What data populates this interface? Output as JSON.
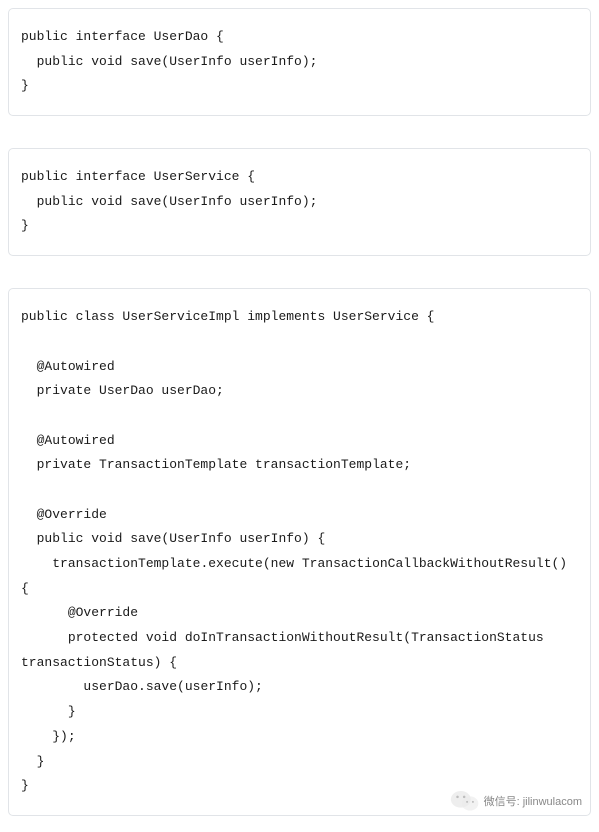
{
  "codeBlocks": [
    {
      "content": "public interface UserDao {\n  public void save(UserInfo userInfo);\n}"
    },
    {
      "content": "public interface UserService {\n  public void save(UserInfo userInfo);\n}"
    },
    {
      "content": "public class UserServiceImpl implements UserService {\n\n  @Autowired\n  private UserDao userDao;\n\n  @Autowired\n  private TransactionTemplate transactionTemplate;\n\n  @Override\n  public void save(UserInfo userInfo) {\n    transactionTemplate.execute(new TransactionCallbackWithoutResult() {\n      @Override\n      protected void doInTransactionWithoutResult(TransactionStatus transactionStatus) {\n        userDao.save(userInfo);\n      }\n    });\n  }\n}"
    }
  ],
  "watermark": {
    "label": "微信号: jilinwulacom"
  }
}
